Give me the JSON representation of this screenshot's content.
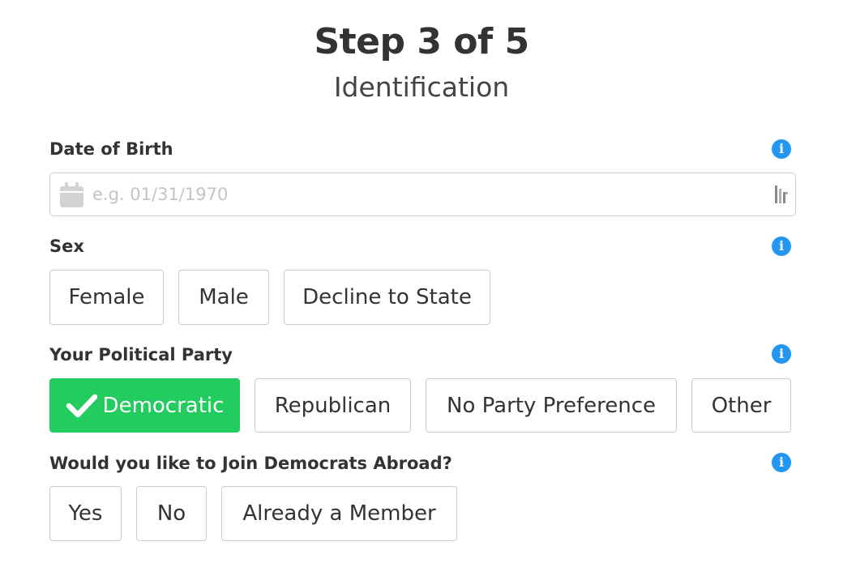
{
  "header": {
    "step": "Step 3 of 5",
    "title": "Identification"
  },
  "date_of_birth": {
    "label": "Date of Birth",
    "placeholder": "e.g. 01/31/1970",
    "value": ""
  },
  "sex": {
    "label": "Sex",
    "options": [
      "Female",
      "Male",
      "Decline to State"
    ]
  },
  "party": {
    "label": "Your Political Party",
    "options": [
      "Democratic",
      "Republican",
      "No Party Preference",
      "Other"
    ],
    "selected": "Democratic"
  },
  "join": {
    "label": "Would you like to Join Democrats Abroad?",
    "options": [
      "Yes",
      "No",
      "Already a Member"
    ]
  },
  "info_icon": "i",
  "colors": {
    "selected": "#22cc5e",
    "info": "#2196f3",
    "border": "#cccccc"
  },
  "icons": {
    "calendar": "calendar-icon",
    "info": "info-icon",
    "check": "check-icon",
    "picker": "picker-icon"
  }
}
